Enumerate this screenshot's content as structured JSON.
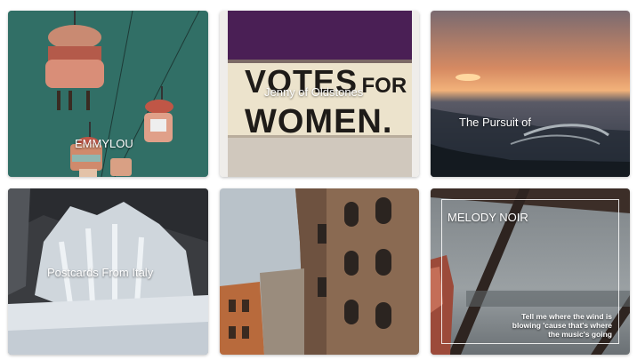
{
  "gallery": {
    "cards": [
      {
        "caption": "EMMYLOU"
      },
      {
        "caption": "Jenny of Oldstones",
        "banner_text": [
          "VOTES",
          "FOR",
          "WOMEN."
        ]
      },
      {
        "caption": "The Pursuit of"
      },
      {
        "caption": "Postcards From Italy"
      },
      {
        "caption": ""
      },
      {
        "caption": "MELODY NOIR",
        "quote": "Tell me where the wind is blowing 'cause that's where the music's going"
      }
    ]
  }
}
